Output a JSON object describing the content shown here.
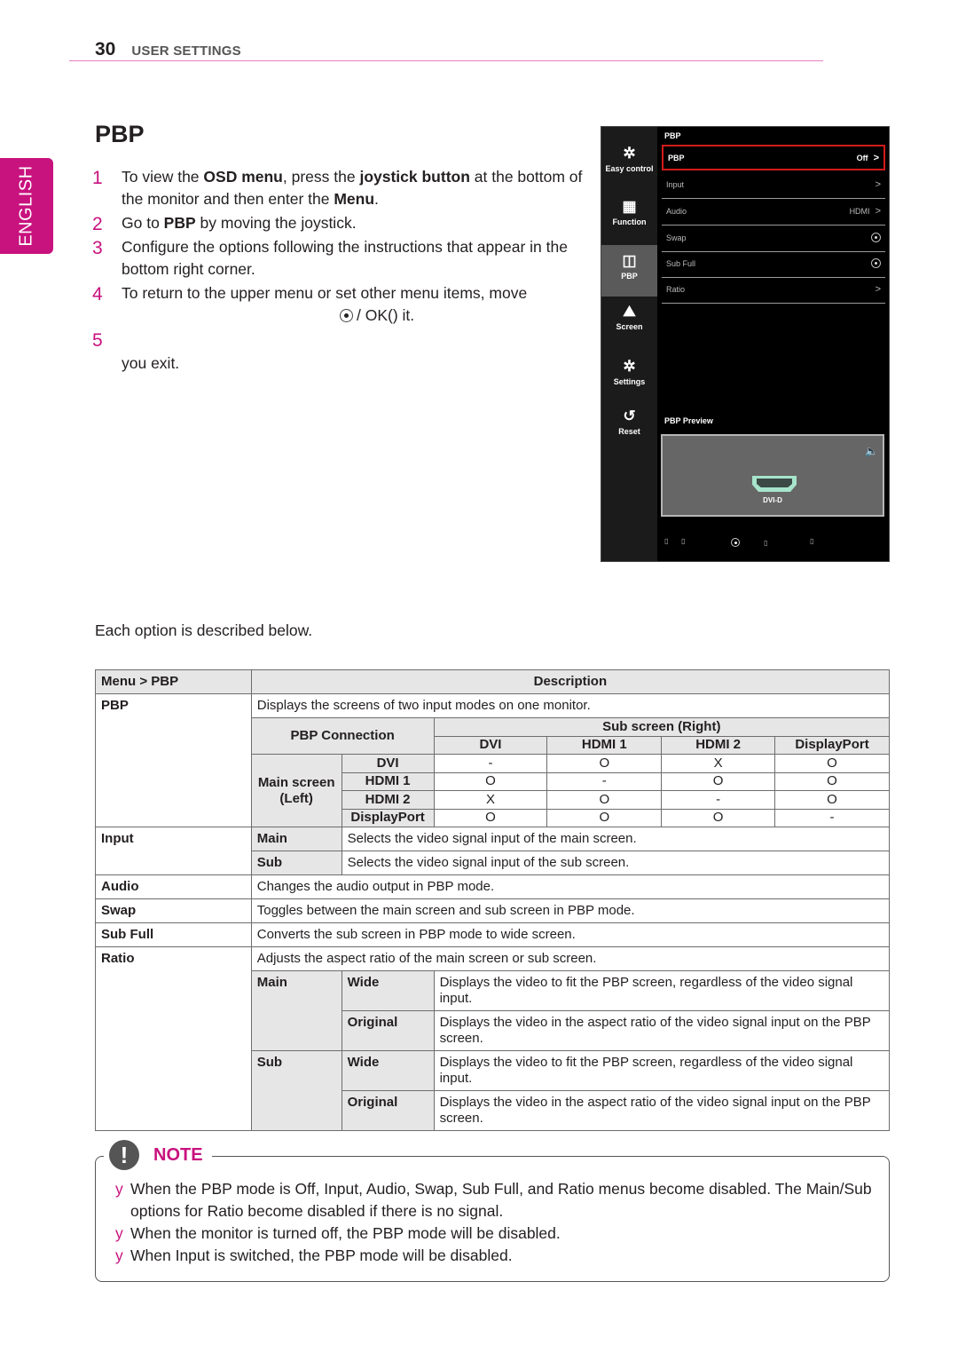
{
  "header": {
    "page_number": "30",
    "section": "USER SETTINGS"
  },
  "language_tab": "ENGLISH",
  "title": "PBP",
  "steps": [
    {
      "n": "1",
      "parts": [
        "To view the ",
        "OSD menu",
        ", press the ",
        "joystick button",
        " at the bottom of the monitor and then enter the ",
        "Menu",
        "."
      ]
    },
    {
      "n": "2",
      "parts": [
        "Go to ",
        "PBP",
        " by moving the joystick."
      ]
    },
    {
      "n": "3",
      "text": "Configure the options following the instructions that appear in the bottom right corner."
    },
    {
      "n": "4",
      "line1": "To return to the upper menu or set other menu items, move",
      "line2": "/ OK() it."
    },
    {
      "n": "5",
      "line1": "",
      "line2": "you exit."
    }
  ],
  "osd": {
    "nav": [
      {
        "icon": "easy-control-icon",
        "glyph": "✲",
        "label": "Easy control"
      },
      {
        "icon": "function-icon",
        "glyph": "▦",
        "label": "Function"
      },
      {
        "icon": "pbp-icon",
        "glyph": "◫",
        "label": "PBP",
        "active": true
      },
      {
        "icon": "screen-icon",
        "glyph": "⛰",
        "label": "Screen"
      },
      {
        "icon": "settings-icon",
        "glyph": "✲",
        "label": "Settings"
      },
      {
        "icon": "reset-icon",
        "glyph": "↺",
        "label": "Reset"
      }
    ],
    "heading": "PBP",
    "items": [
      {
        "label": "PBP",
        "value": "Off",
        "control": "chevron",
        "selected": true
      },
      {
        "label": "Input",
        "value": "",
        "control": "chevron"
      },
      {
        "label": "Audio",
        "value": "HDMI",
        "control": "chevron"
      },
      {
        "label": "Swap",
        "value": "",
        "control": "radio"
      },
      {
        "label": "Sub Full",
        "value": "",
        "control": "radio"
      },
      {
        "label": "Ratio",
        "value": "",
        "control": "chevron"
      }
    ],
    "chevron": ">",
    "preview_label": "PBP Preview",
    "preview_connector": "DVI-D",
    "speaker_glyph": "🔈",
    "footer_glyph": "▯"
  },
  "intro": "Each option is described below.",
  "table": {
    "head": {
      "menu": "Menu > PBP",
      "desc": "Description"
    },
    "pbp": {
      "label": "PBP",
      "desc": "Displays the screens of two input modes on one monitor.",
      "conn_label": "PBP Connection",
      "sub_label": "Sub screen (Right)",
      "main_label_1": "Main screen",
      "main_label_2": "(Left)",
      "columns": [
        "DVI",
        "HDMI 1",
        "HDMI 2",
        "DisplayPort"
      ],
      "rows": [
        {
          "input": "DVI",
          "cells": [
            "-",
            "O",
            "X",
            "O"
          ]
        },
        {
          "input": "HDMI 1",
          "cells": [
            "O",
            "-",
            "O",
            "O"
          ]
        },
        {
          "input": "HDMI 2",
          "cells": [
            "X",
            "O",
            "-",
            "O"
          ]
        },
        {
          "input": "DisplayPort",
          "cells": [
            "O",
            "O",
            "O",
            "-"
          ]
        }
      ]
    },
    "input": {
      "label": "Input",
      "main": "Main",
      "main_desc": "Selects the video signal input of the main screen.",
      "sub": "Sub",
      "sub_desc": "Selects the video signal input of the sub screen."
    },
    "audio": {
      "label": "Audio",
      "desc": "Changes the audio output in PBP mode."
    },
    "swap": {
      "label": "Swap",
      "desc": "Toggles between the main screen and sub screen in PBP mode."
    },
    "subfull": {
      "label": "Sub Full",
      "desc": "Converts the sub screen in PBP mode to wide screen."
    },
    "ratio": {
      "label": "Ratio",
      "desc": "Adjusts the aspect ratio of the main screen or sub screen.",
      "main": "Main",
      "sub": "Sub",
      "wide": "Wide",
      "original": "Original",
      "wide_desc": "Displays the video to fit the PBP screen, regardless of the video signal input.",
      "original_desc": "Displays the video in the aspect ratio of the video signal input on the PBP screen."
    }
  },
  "note": {
    "icon": "!",
    "title": "NOTE",
    "bullet": "y",
    "items": [
      "When the PBP mode is Off, Input, Audio, Swap, Sub Full, and Ratio menus become disabled. The Main/Sub options for Ratio become disabled if there is no signal.",
      "When the monitor is turned off, the PBP mode will be disabled.",
      "When Input is switched, the PBP mode will be disabled."
    ]
  }
}
